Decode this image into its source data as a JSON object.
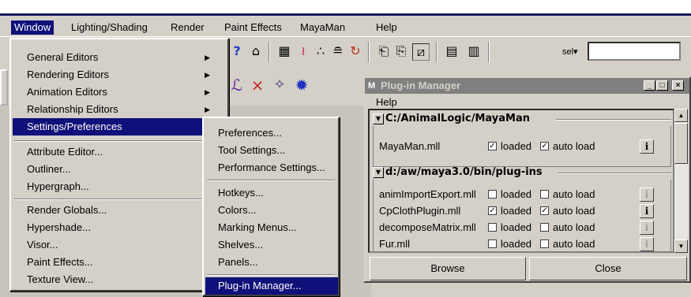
{
  "menubar": {
    "items": [
      "Window",
      "Lighting/Shading",
      "Render",
      "Paint Effects",
      "MayaMan",
      "Help"
    ]
  },
  "toolbar": {
    "sel_label": "sel▾"
  },
  "window_menu": {
    "items": [
      {
        "label": "General Editors",
        "submenu": true
      },
      {
        "label": "Rendering Editors",
        "submenu": true
      },
      {
        "label": "Animation Editors",
        "submenu": true
      },
      {
        "label": "Relationship Editors",
        "submenu": true
      },
      {
        "label": "Settings/Preferences",
        "submenu": true,
        "highlighted": true
      },
      {
        "label": "Attribute Editor..."
      },
      {
        "label": "Outliner..."
      },
      {
        "label": "Hypergraph..."
      },
      {
        "label": "Render Globals..."
      },
      {
        "label": "Hypershade..."
      },
      {
        "label": "Visor..."
      },
      {
        "label": "Paint Effects..."
      },
      {
        "label": "Texture View..."
      }
    ]
  },
  "settings_menu": {
    "items": [
      {
        "label": "Preferences..."
      },
      {
        "label": "Tool Settings..."
      },
      {
        "label": "Performance Settings..."
      },
      {
        "label": "Hotkeys..."
      },
      {
        "label": "Colors..."
      },
      {
        "label": "Marking Menus..."
      },
      {
        "label": "Shelves..."
      },
      {
        "label": "Panels..."
      },
      {
        "label": "Plug-in Manager...",
        "highlighted": true
      }
    ]
  },
  "plugin_manager": {
    "title": "Plug-in Manager",
    "title_icon": "M",
    "menu_help": "Help",
    "loaded_label": "loaded",
    "autoload_label": "auto load",
    "info_glyph": "i",
    "sections": [
      {
        "path": "C:/AnimalLogic/MayaMan",
        "plugins": [
          {
            "name": "MayaMan.mll",
            "loaded": true,
            "auto_load": true,
            "info_enabled": true
          }
        ]
      },
      {
        "path": "d:/aw/maya3.0/bin/plug-ins",
        "plugins": [
          {
            "name": "animImportExport.mll",
            "loaded": false,
            "auto_load": false,
            "info_enabled": false
          },
          {
            "name": "CpClothPlugin.mll",
            "loaded": true,
            "auto_load": true,
            "info_enabled": true
          },
          {
            "name": "decomposeMatrix.mll",
            "loaded": false,
            "auto_load": false,
            "info_enabled": false
          },
          {
            "name": "Fur.mll",
            "loaded": false,
            "auto_load": false,
            "info_enabled": false
          }
        ]
      }
    ],
    "buttons": {
      "browse": "Browse",
      "close": "Close"
    }
  },
  "colors": {
    "highlight": "#10107a",
    "face": "#d4d0c8",
    "title_inactive": "#808080"
  }
}
